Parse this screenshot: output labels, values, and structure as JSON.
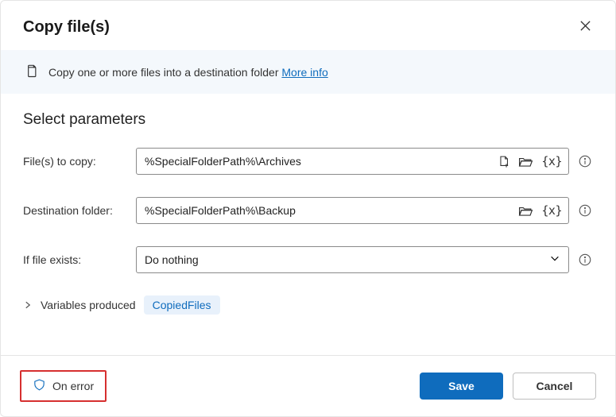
{
  "header": {
    "title": "Copy file(s)"
  },
  "info": {
    "text": "Copy one or more files into a destination folder ",
    "link": "More info"
  },
  "section": {
    "title": "Select parameters"
  },
  "fields": {
    "files": {
      "label": "File(s) to copy:",
      "value": "%SpecialFolderPath%\\Archives"
    },
    "dest": {
      "label": "Destination folder:",
      "value": "%SpecialFolderPath%\\Backup"
    },
    "exists": {
      "label": "If file exists:",
      "value": "Do nothing"
    }
  },
  "vars": {
    "label": "Variables produced",
    "chip": "CopiedFiles"
  },
  "icons": {
    "varx": "{x}"
  },
  "footer": {
    "onError": "On error",
    "save": "Save",
    "cancel": "Cancel"
  }
}
